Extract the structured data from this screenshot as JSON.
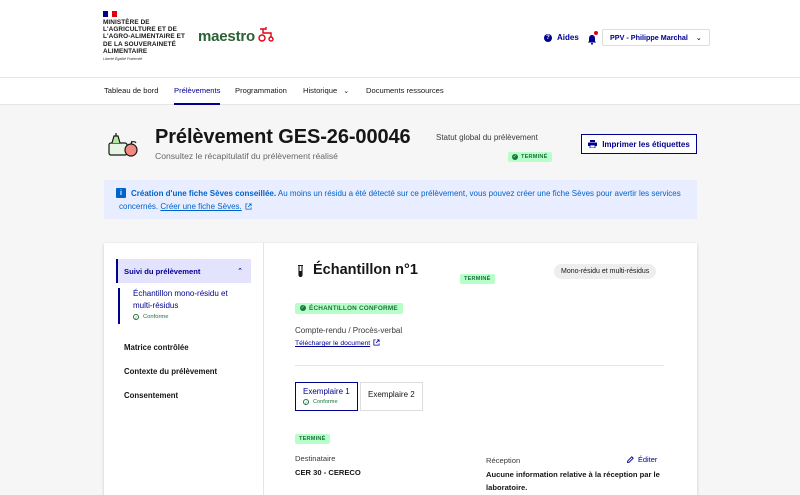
{
  "header": {
    "gov_name": "Ministère de l'Agriculture et de l'Agro-alimentaire et de la Souveraineté alimentaire",
    "gov_motto": "Liberté Égalité Fraternité",
    "brand": "maestro",
    "aides": "Aides",
    "user": "PPV - Philippe Marchal"
  },
  "nav": {
    "items": [
      "Tableau de bord",
      "Prélèvements",
      "Programmation",
      "Historique",
      "Documents ressources"
    ],
    "active": "Prélèvements"
  },
  "page": {
    "title": "Prélèvement GES-26-00046",
    "subtitle": "Consultez le récapitulatif du prélèvement réalisé",
    "statut_label": "Statut global du prélèvement",
    "statut_value": "Terminé",
    "print_button": "Imprimer les étiquettes"
  },
  "alert": {
    "title": "Création d'une fiche Sèves conseillée.",
    "body": "Au moins un résidu a été détecté sur ce prélèvement, vous pouvez créer une fiche Sèves pour avertir les services concernés.",
    "link": "Créer une fiche Sèves."
  },
  "sidebar": {
    "active": "Suivi du prélèvement",
    "sub_item": "Échantillon mono-résidu et multi-résidus",
    "sub_status": "Conforme",
    "links": [
      "Matrice contrôlée",
      "Contexte du prélèvement",
      "Consentement"
    ]
  },
  "echantillon": {
    "title": "Échantillon n°1",
    "status": "Terminé",
    "tag": "Mono-résidu et multi-résidus",
    "conformite": "Échantillon conforme",
    "cr_label": "Compte-rendu / Procès-verbal",
    "cr_link": "Télécharger le document",
    "tabs": [
      {
        "label": "Exemplaire 1",
        "status": "Conforme"
      },
      {
        "label": "Exemplaire 2"
      }
    ],
    "exemplaire_status": "Terminé",
    "destinataire_label": "Destinataire",
    "destinataire_value": "CER 30 - CERECO",
    "reception_label": "Réception",
    "edit_label": "Éditer",
    "reception_value": "Aucune information relative à la réception par le laboratoire."
  },
  "colors": {
    "primary": "#000091",
    "success_bg": "#b8fec9",
    "success_text": "#18753c",
    "info_bg": "#e8edff",
    "info_text": "#0063cb"
  }
}
